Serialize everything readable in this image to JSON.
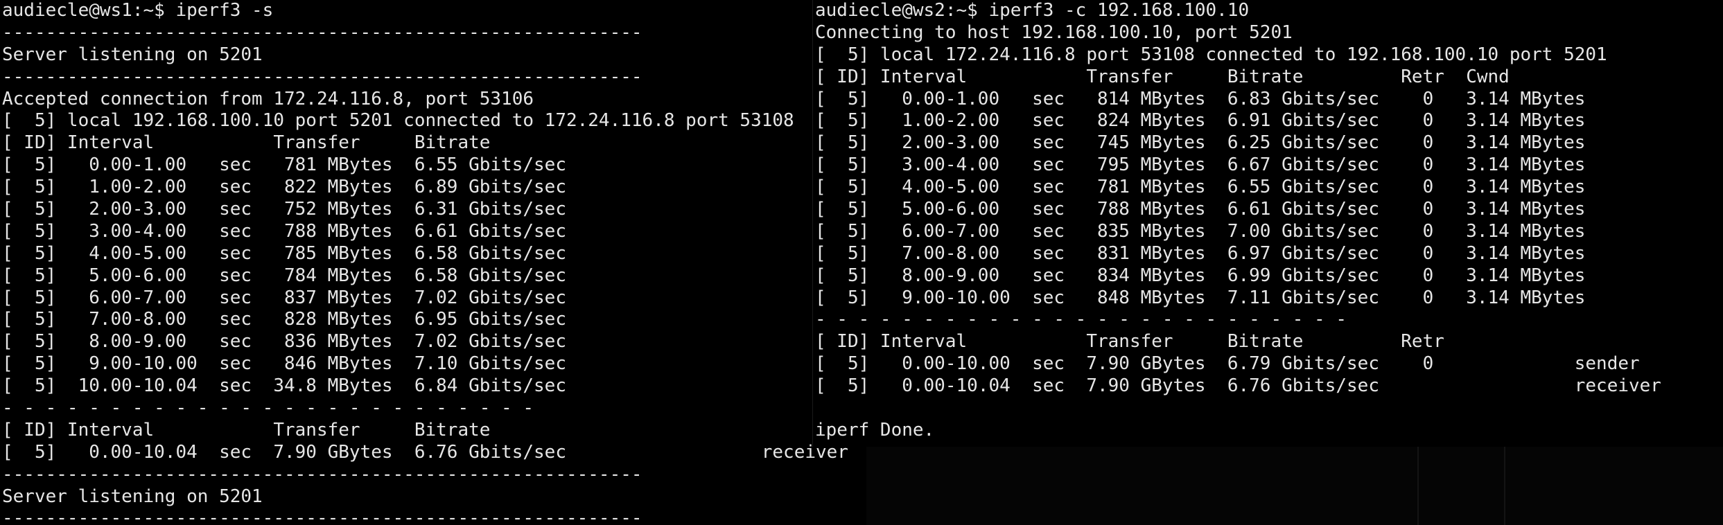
{
  "left_terminal": {
    "lines": [
      "audiecle@ws1:~$ iperf3 -s",
      "-----------------------------------------------------------",
      "Server listening on 5201",
      "-----------------------------------------------------------",
      "Accepted connection from 172.24.116.8, port 53106",
      "[  5] local 192.168.100.10 port 5201 connected to 172.24.116.8 port 53108",
      "[ ID] Interval           Transfer     Bitrate",
      "[  5]   0.00-1.00   sec   781 MBytes  6.55 Gbits/sec",
      "[  5]   1.00-2.00   sec   822 MBytes  6.89 Gbits/sec",
      "[  5]   2.00-3.00   sec   752 MBytes  6.31 Gbits/sec",
      "[  5]   3.00-4.00   sec   788 MBytes  6.61 Gbits/sec",
      "[  5]   4.00-5.00   sec   785 MBytes  6.58 Gbits/sec",
      "[  5]   5.00-6.00   sec   784 MBytes  6.58 Gbits/sec",
      "[  5]   6.00-7.00   sec   837 MBytes  7.02 Gbits/sec",
      "[  5]   7.00-8.00   sec   828 MBytes  6.95 Gbits/sec",
      "[  5]   8.00-9.00   sec   836 MBytes  7.02 Gbits/sec",
      "[  5]   9.00-10.00  sec   846 MBytes  7.10 Gbits/sec",
      "[  5]  10.00-10.04  sec  34.8 MBytes  6.84 Gbits/sec",
      "- - - - - - - - - - - - - - - - - - - - - - - - -",
      "[ ID] Interval           Transfer     Bitrate",
      "[  5]   0.00-10.04  sec  7.90 GBytes  6.76 Gbits/sec                  receiver",
      "-----------------------------------------------------------",
      "Server listening on 5201",
      "-----------------------------------------------------------"
    ]
  },
  "right_terminal": {
    "lines": [
      "audiecle@ws2:~$ iperf3 -c 192.168.100.10",
      "Connecting to host 192.168.100.10, port 5201",
      "[  5] local 172.24.116.8 port 53108 connected to 192.168.100.10 port 5201",
      "[ ID] Interval           Transfer     Bitrate         Retr  Cwnd",
      "[  5]   0.00-1.00   sec   814 MBytes  6.83 Gbits/sec    0   3.14 MBytes",
      "[  5]   1.00-2.00   sec   824 MBytes  6.91 Gbits/sec    0   3.14 MBytes",
      "[  5]   2.00-3.00   sec   745 MBytes  6.25 Gbits/sec    0   3.14 MBytes",
      "[  5]   3.00-4.00   sec   795 MBytes  6.67 Gbits/sec    0   3.14 MBytes",
      "[  5]   4.00-5.00   sec   781 MBytes  6.55 Gbits/sec    0   3.14 MBytes",
      "[  5]   5.00-6.00   sec   788 MBytes  6.61 Gbits/sec    0   3.14 MBytes",
      "[  5]   6.00-7.00   sec   835 MBytes  7.00 Gbits/sec    0   3.14 MBytes",
      "[  5]   7.00-8.00   sec   831 MBytes  6.97 Gbits/sec    0   3.14 MBytes",
      "[  5]   8.00-9.00   sec   834 MBytes  6.99 Gbits/sec    0   3.14 MBytes",
      "[  5]   9.00-10.00  sec   848 MBytes  7.11 Gbits/sec    0   3.14 MBytes",
      "- - - - - - - - - - - - - - - - - - - - - - - - -",
      "[ ID] Interval           Transfer     Bitrate         Retr",
      "[  5]   0.00-10.00  sec  7.90 GBytes  6.79 Gbits/sec    0             sender",
      "[  5]   0.00-10.04  sec  7.90 GBytes  6.76 Gbits/sec                  receiver",
      "",
      "iperf Done."
    ]
  }
}
